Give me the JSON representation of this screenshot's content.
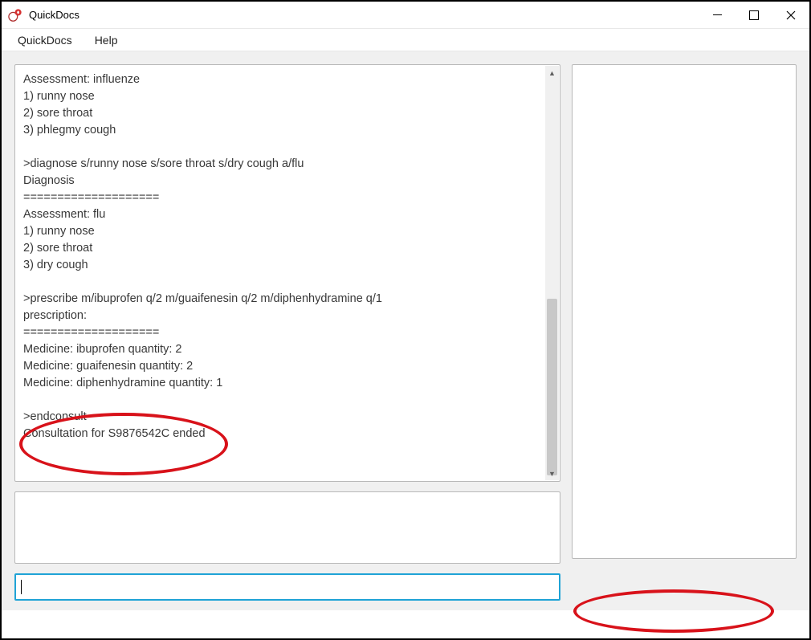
{
  "titlebar": {
    "app_title": "QuickDocs"
  },
  "menubar": {
    "items": [
      "QuickDocs",
      "Help"
    ]
  },
  "log": {
    "text": "Assessment: influenze\n1) runny nose\n2) sore throat\n3) phlegmy cough\n\n>diagnose s/runny nose s/sore throat s/dry cough a/flu\nDiagnosis\n====================\nAssessment: flu\n1) runny nose\n2) sore throat\n3) dry cough\n\n>prescribe m/ibuprofen q/2 m/guaifenesin q/2 m/diphenhydramine q/1\nprescription:\n====================\nMedicine: ibuprofen quantity: 2\nMedicine: guaifenesin quantity: 2\nMedicine: diphenhydramine quantity: 1\n\n>endconsult\nConsultation for S9876542C ended"
  },
  "command_input": {
    "value": ""
  }
}
